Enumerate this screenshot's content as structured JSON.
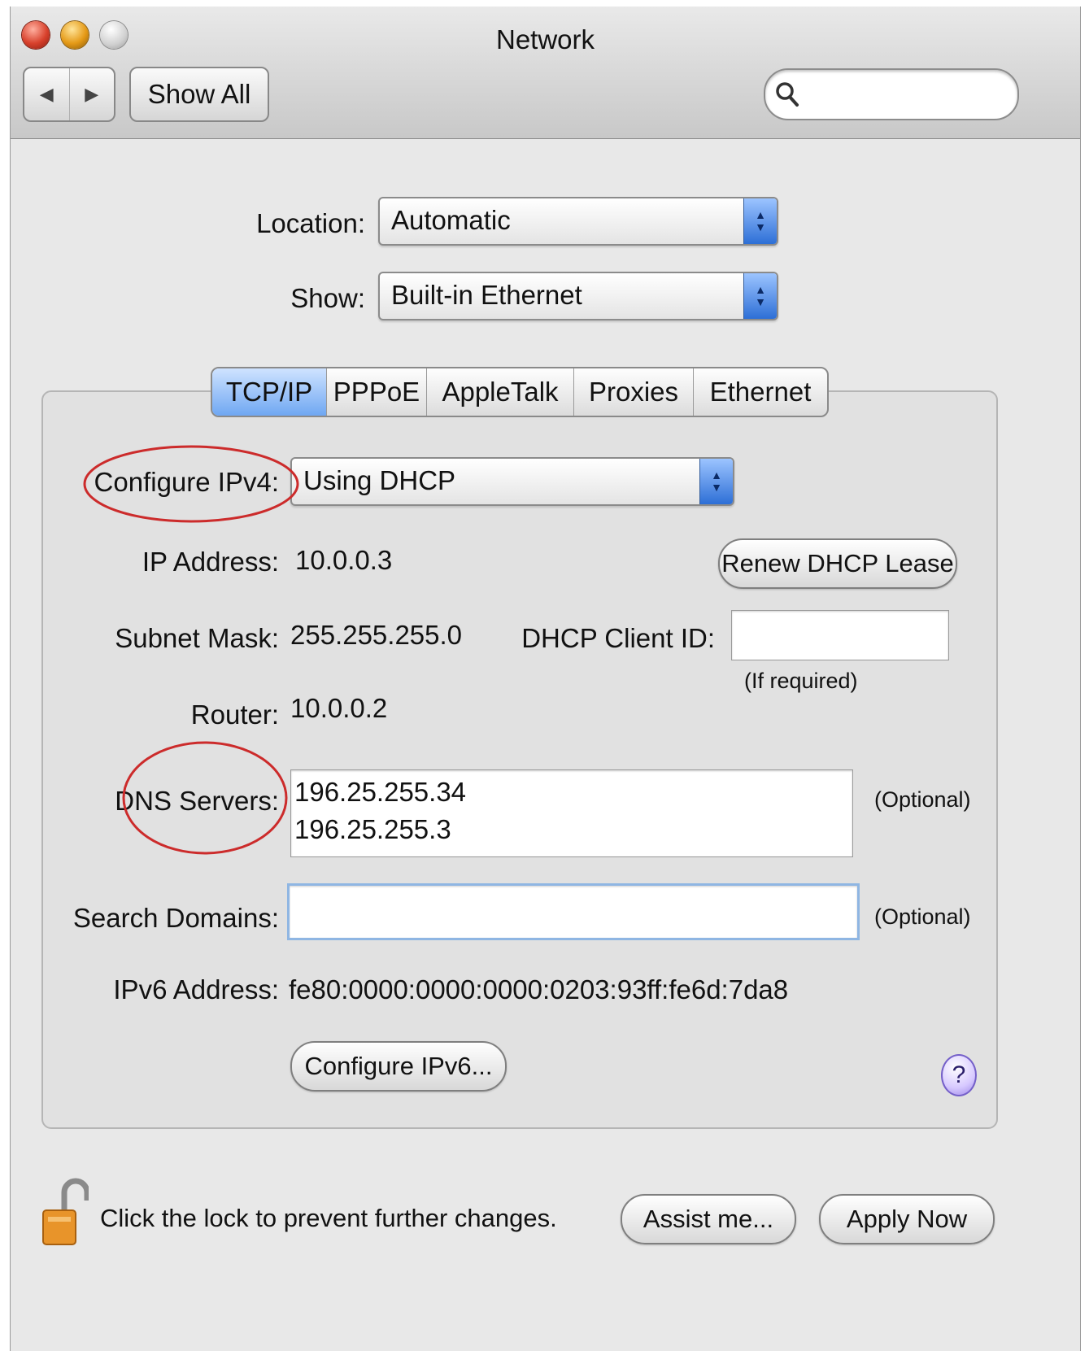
{
  "window": {
    "title": "Network"
  },
  "toolbar": {
    "back": "◀",
    "forward": "▶",
    "show_all": "Show All",
    "search_value": ""
  },
  "location": {
    "label": "Location:",
    "value": "Automatic"
  },
  "show": {
    "label": "Show:",
    "value": "Built-in Ethernet"
  },
  "tabs": [
    {
      "label": "TCP/IP",
      "active": true
    },
    {
      "label": "PPPoE",
      "active": false
    },
    {
      "label": "AppleTalk",
      "active": false
    },
    {
      "label": "Proxies",
      "active": false
    },
    {
      "label": "Ethernet",
      "active": false
    }
  ],
  "tcpip": {
    "configure_ipv4": {
      "label": "Configure IPv4:",
      "value": "Using DHCP"
    },
    "ip_address": {
      "label": "IP Address:",
      "value": "10.0.0.3"
    },
    "renew_button": "Renew DHCP Lease",
    "subnet_mask": {
      "label": "Subnet Mask:",
      "value": "255.255.255.0"
    },
    "dhcp_client_id": {
      "label": "DHCP Client ID:",
      "value": "",
      "hint": "(If required)"
    },
    "router": {
      "label": "Router:",
      "value": "10.0.0.2"
    },
    "dns_servers": {
      "label": "DNS Servers:",
      "values": [
        "196.25.255.34",
        "196.25.255.3"
      ],
      "hint": "(Optional)"
    },
    "search_domains": {
      "label": "Search Domains:",
      "value": "",
      "hint": "(Optional)"
    },
    "ipv6_address": {
      "label": "IPv6 Address:",
      "value": "fe80:0000:0000:0000:0203:93ff:fe6d:7da8"
    },
    "configure_ipv6_button": "Configure IPv6...",
    "help": "?"
  },
  "footer": {
    "lock_text": "Click the lock to prevent further changes.",
    "assist_button": "Assist me...",
    "apply_button": "Apply Now"
  },
  "colors": {
    "annotation_circle": "#cc2b2b",
    "active_tab": "#6fa7f2",
    "focus_ring": "#8fb6e3"
  }
}
